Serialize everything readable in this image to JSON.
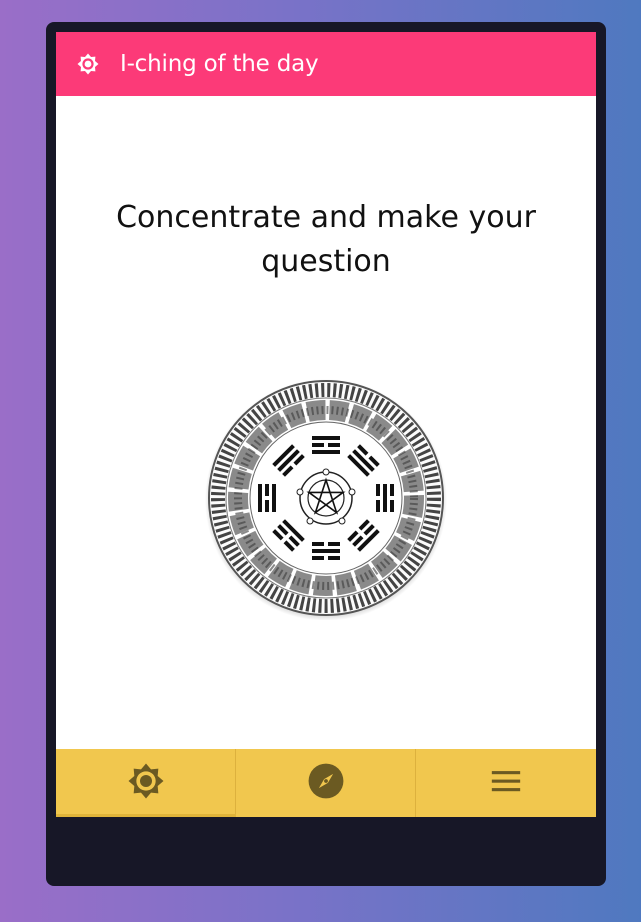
{
  "appbar": {
    "title": "I-ching of the day",
    "icon": "brightness-icon",
    "color": "#fc3a78"
  },
  "main": {
    "prompt": "Concentrate and make your question",
    "image": "i-ching-trigram-coin"
  },
  "bottom_nav": {
    "color": "#f1c74e",
    "icon_color": "#6b5a22",
    "items": [
      {
        "icon": "brightness-icon",
        "active": true
      },
      {
        "icon": "compass-icon",
        "active": false
      },
      {
        "icon": "menu-icon",
        "active": false
      }
    ]
  }
}
